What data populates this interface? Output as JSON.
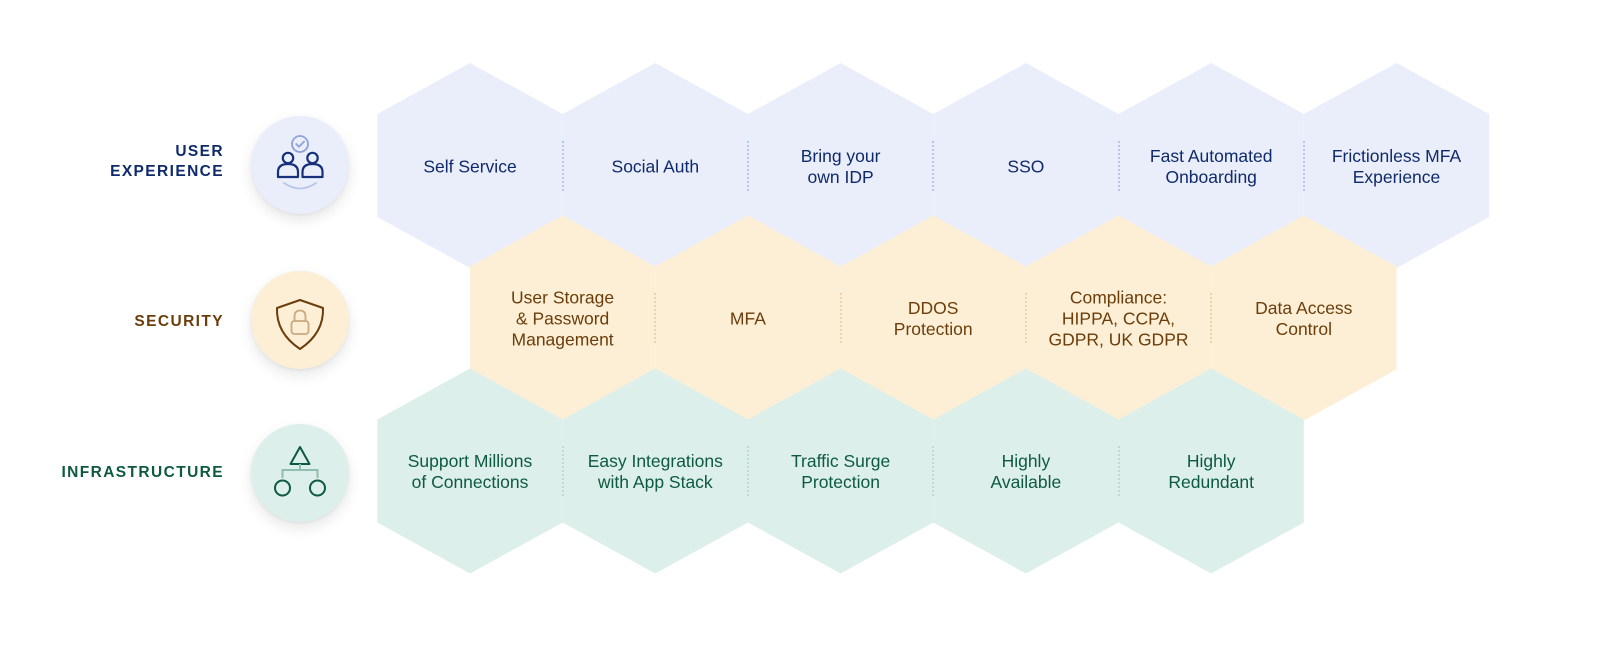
{
  "rows": [
    {
      "id": "user-experience",
      "label_lines": [
        "USER",
        "EXPERIENCE"
      ],
      "icon": "users-check-icon",
      "colors": {
        "text": "#0f2a6b",
        "hex_fill": "#eaeefa",
        "badge_fill": "#eaeefa",
        "divider": "#b8c6ef"
      },
      "items": [
        {
          "label": "Self Service"
        },
        {
          "label": "Social Auth"
        },
        {
          "label": "Bring your own IDP"
        },
        {
          "label": "SSO"
        },
        {
          "label": "Fast Automated Onboarding"
        },
        {
          "label": "Frictionless MFA Experience"
        }
      ],
      "item_lines": [
        [
          "Self Service"
        ],
        [
          "Social Auth"
        ],
        [
          "Bring your",
          "own IDP"
        ],
        [
          "SSO"
        ],
        [
          "Fast Automated",
          "Onboarding"
        ],
        [
          "Frictionless MFA",
          "Experience"
        ]
      ]
    },
    {
      "id": "security",
      "label_lines": [
        "SECURITY"
      ],
      "icon": "shield-lock-icon",
      "colors": {
        "text": "#6b3d0a",
        "hex_fill": "#fdefd6",
        "badge_fill": "#fdefd6",
        "divider": "#ecd3ae"
      },
      "items": [
        {
          "label": "User Storage & Password Management"
        },
        {
          "label": "MFA"
        },
        {
          "label": "DDOS Protection"
        },
        {
          "label": "Compliance: HIPPA, CCPA, GDPR, UK GDPR"
        },
        {
          "label": "Data Access Control"
        }
      ],
      "item_lines": [
        [
          "User Storage",
          "& Password",
          "Management"
        ],
        [
          "MFA"
        ],
        [
          "DDOS",
          "Protection"
        ],
        [
          "Compliance:",
          "HIPPA, CCPA,",
          "GDPR, UK GDPR"
        ],
        [
          "Data Access",
          "Control"
        ]
      ]
    },
    {
      "id": "infrastructure",
      "label_lines": [
        "INFRASTRUCTURE"
      ],
      "icon": "network-hierarchy-icon",
      "colors": {
        "text": "#0d5a40",
        "hex_fill": "#dcefea",
        "badge_fill": "#dcefea",
        "divider": "#bcdcd3"
      },
      "items": [
        {
          "label": "Support Millions of Connections"
        },
        {
          "label": "Easy Integrations with App Stack"
        },
        {
          "label": "Traffic Surge Protection"
        },
        {
          "label": "Highly Available"
        },
        {
          "label": "Highly Redundant"
        }
      ],
      "item_lines": [
        [
          "Support Millions",
          "of Connections"
        ],
        [
          "Easy Integrations",
          "with App Stack"
        ],
        [
          "Traffic Surge",
          "Protection"
        ],
        [
          "Highly",
          "Available"
        ],
        [
          "Highly",
          "Redundant"
        ]
      ]
    }
  ]
}
